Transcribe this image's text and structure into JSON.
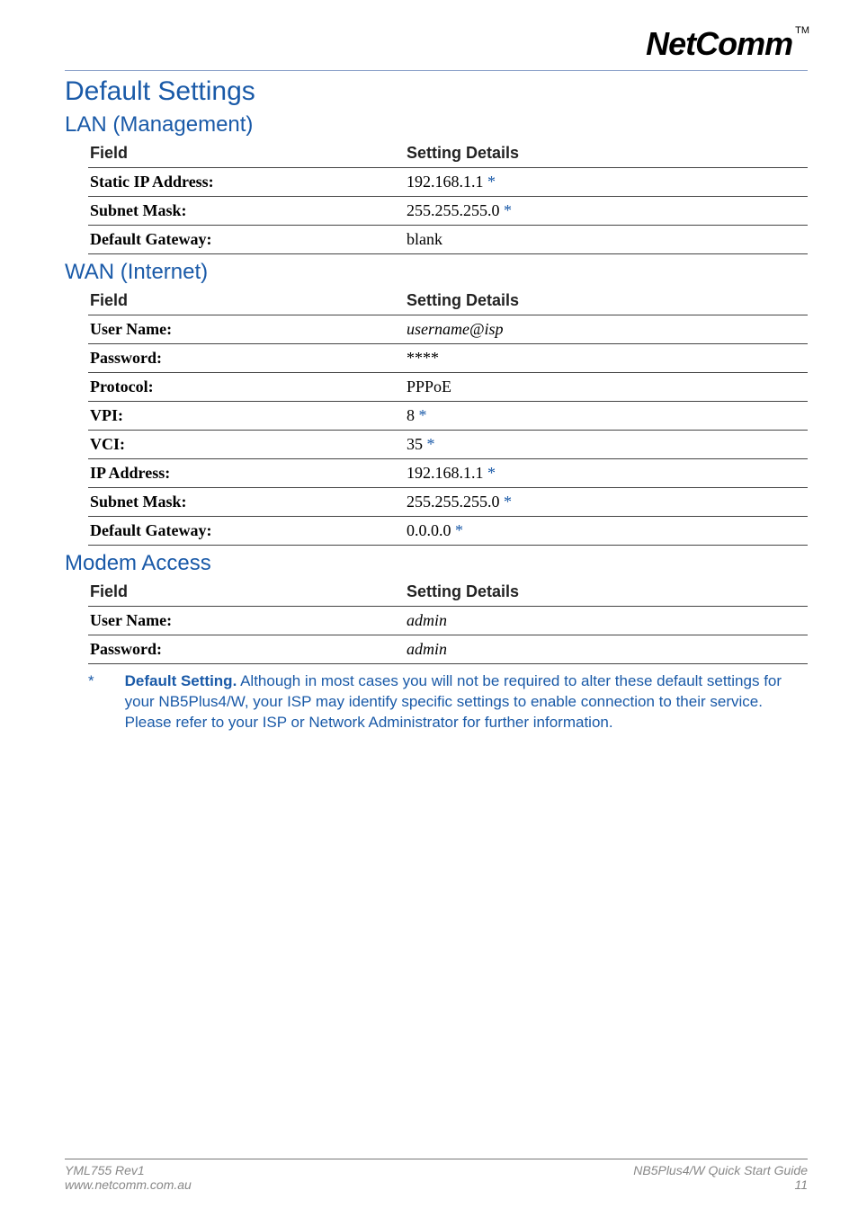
{
  "logo": {
    "text": "NetComm",
    "tm": "TM"
  },
  "headings": {
    "main": "Default Settings",
    "lan": "LAN (Management)",
    "wan": "WAN (Internet)",
    "modem": "Modem Access"
  },
  "table_headers": {
    "field": "Field",
    "details": "Setting Details"
  },
  "lan_rows": [
    {
      "field": "Static IP Address:",
      "value": "192.168.1.1",
      "star": "*"
    },
    {
      "field": "Subnet Mask:",
      "value": "255.255.255.0 ",
      "star": "*"
    },
    {
      "field": "Default Gateway:",
      "value": "blank",
      "star": ""
    }
  ],
  "wan_rows": [
    {
      "field": "User Name:",
      "value": "username@isp",
      "star": "",
      "italic": true
    },
    {
      "field": "Password:",
      "value": "****",
      "star": ""
    },
    {
      "field": "Protocol:",
      "value": "PPPoE",
      "star": ""
    },
    {
      "field": "VPI:",
      "value": "8",
      "star": "*"
    },
    {
      "field": "VCI:",
      "value": "35",
      "star": "*"
    },
    {
      "field": "IP Address:",
      "value": "192.168.1.1",
      "star": "*"
    },
    {
      "field": "Subnet Mask:",
      "value": "255.255.255.0 ",
      "star": "*"
    },
    {
      "field": "Default Gateway:",
      "value": "0.0.0.0",
      "star": "*"
    }
  ],
  "modem_rows": [
    {
      "field": "User Name:",
      "value": "admin",
      "star": "",
      "italic": true
    },
    {
      "field": "Password:",
      "value": "admin",
      "star": "",
      "italic": true
    }
  ],
  "footnote": {
    "marker": "*",
    "bold": "Default Setting.",
    "rest": "  Although in most cases you will not be required to alter these default settings for your NB5Plus4/W, your ISP may identify specific settings to enable connection to their service.  Please refer to your ISP or Network Administrator for further information."
  },
  "footer": {
    "left1": "YML755 Rev1",
    "left2": "www.netcomm.com.au",
    "right1": "NB5Plus4/W Quick Start Guide",
    "right2": "11"
  }
}
